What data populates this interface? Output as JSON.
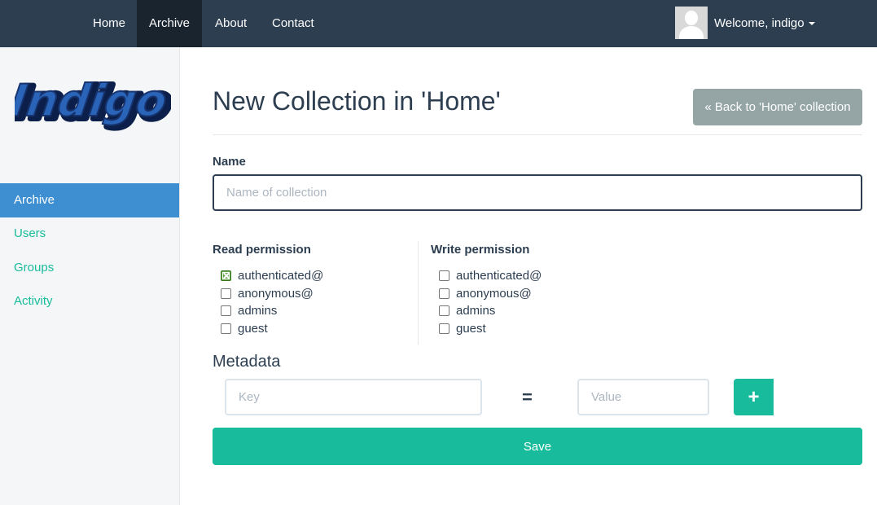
{
  "navbar": {
    "items": [
      {
        "label": "Home"
      },
      {
        "label": "Archive"
      },
      {
        "label": "About"
      },
      {
        "label": "Contact"
      }
    ],
    "welcome": "Welcome, indigo"
  },
  "sidebar": {
    "logo_text": "Indigo",
    "items": [
      {
        "label": "Archive"
      },
      {
        "label": "Users"
      },
      {
        "label": "Groups"
      },
      {
        "label": "Activity"
      }
    ]
  },
  "main": {
    "title": "New Collection in 'Home'",
    "back_button": "« Back to 'Home' collection",
    "name_label": "Name",
    "name_placeholder": "Name of collection",
    "read_permission": {
      "label": "Read permission",
      "options": [
        {
          "label": "authenticated@",
          "checked": true
        },
        {
          "label": "anonymous@",
          "checked": false
        },
        {
          "label": "admins",
          "checked": false
        },
        {
          "label": "guest",
          "checked": false
        }
      ]
    },
    "write_permission": {
      "label": "Write permission",
      "options": [
        {
          "label": "authenticated@",
          "checked": false
        },
        {
          "label": "anonymous@",
          "checked": false
        },
        {
          "label": "admins",
          "checked": false
        },
        {
          "label": "guest",
          "checked": false
        }
      ]
    },
    "metadata": {
      "title": "Metadata",
      "key_placeholder": "Key",
      "equals": "=",
      "value_placeholder": "Value",
      "add_symbol": "+"
    },
    "save_button": "Save"
  },
  "colors": {
    "navbar": "#2c3e50",
    "accent": "#18bc9c",
    "sidebar_active": "#3d8fd1",
    "back_button": "#95a5a6"
  }
}
